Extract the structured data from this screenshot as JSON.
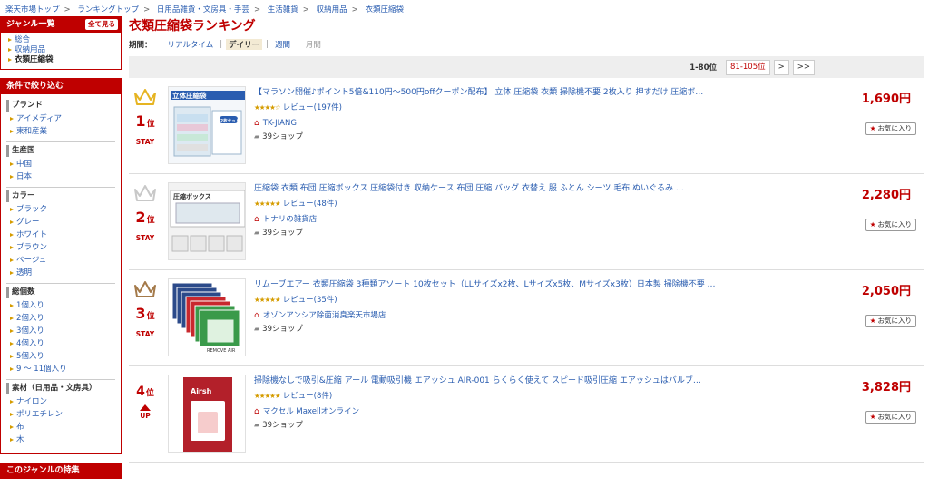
{
  "breadcrumb": [
    "楽天市場トップ",
    "ランキングトップ",
    "日用品雑貨・文房具・手芸",
    "生活雑貨",
    "収納用品",
    "衣類圧縮袋"
  ],
  "sidebar": {
    "genre_title": "ジャンル一覧",
    "all_button": "全て見る",
    "genres": [
      {
        "label": "総合",
        "current": false
      },
      {
        "label": "収納用品",
        "current": false
      },
      {
        "label": "衣類圧縮袋",
        "current": true
      }
    ],
    "filter_title": "条件で絞り込む",
    "filters": [
      {
        "heading": "ブランド",
        "items": [
          "アイメディア",
          "東和産業"
        ]
      },
      {
        "heading": "生産国",
        "items": [
          "中国",
          "日本"
        ]
      },
      {
        "heading": "カラー",
        "items": [
          "ブラック",
          "グレー",
          "ホワイト",
          "ブラウン",
          "ベージュ",
          "透明"
        ]
      },
      {
        "heading": "総個数",
        "items": [
          "1個入り",
          "2個入り",
          "3個入り",
          "4個入り",
          "5個入り",
          "9 ～ 11個入り"
        ]
      },
      {
        "heading": "素材（日用品・文房具）",
        "items": [
          "ナイロン",
          "ポリエチレン",
          "布",
          "木"
        ]
      }
    ],
    "feature_title": "このジャンルの特集"
  },
  "main": {
    "title": "衣類圧縮袋ランキング",
    "period": {
      "label": "期間：",
      "options": [
        {
          "label": "リアルタイム",
          "state": "link"
        },
        {
          "label": "デイリー",
          "state": "active"
        },
        {
          "label": "週間",
          "state": "link"
        },
        {
          "label": "月間",
          "state": "disabled"
        }
      ]
    },
    "pagination": {
      "current": "1-80位",
      "range": "81-105位",
      "next": ">",
      "last": ">>"
    },
    "fav_label": "お気に入り",
    "items": [
      {
        "rank": "1",
        "rank_suffix": "位",
        "status": "STAY",
        "crown": "gold",
        "name": "【マラソン開催♪ポイント5倍&110円～500円offクーポン配布】 立体 圧縮袋 衣類 掃除機不要 2枚入り 押すだけ 圧縮ボ…",
        "stars": 4,
        "review": "レビュー(197件)",
        "shop": "TK-JIANG",
        "shops": "39ショップ",
        "price": "1,690円",
        "thumb_text": "立体圧縮袋",
        "thumb_badge": "2枚セット"
      },
      {
        "rank": "2",
        "rank_suffix": "位",
        "status": "STAY",
        "crown": "silver",
        "name": "圧縮袋 衣類 布団 圧縮ボックス 圧縮袋付き 収納ケース 布団 圧縮 バッグ 衣替え 服 ふとん シーツ 毛布 ぬいぐるみ …",
        "stars": 4.5,
        "review": "レビュー(48件)",
        "shop": "トナリの雑貨店",
        "shops": "39ショップ",
        "price": "2,280円",
        "thumb_text": "圧縮ボックス"
      },
      {
        "rank": "3",
        "rank_suffix": "位",
        "status": "STAY",
        "crown": "bronze",
        "name": "リムーブエアー 衣類圧縮袋 3種類アソート 10枚セット（LLサイズx2枚、Lサイズx5枚、Mサイズx3枚）日本製 掃除機不要 …",
        "stars": 4.5,
        "review": "レビュー(35件)",
        "shop": "オゾンアンシア除菌消臭楽天市場店",
        "shops": "39ショップ",
        "price": "2,050円",
        "thumb_text": "REMOVE AIR"
      },
      {
        "rank": "4",
        "rank_suffix": "位",
        "status": "UP",
        "crown": "none",
        "name": "掃除機なしで吸引&圧縮 アール 電動吸引機 エアッシュ AIR-001 らくらく使えて スピード吸引圧縮 エアッシュはバルブ…",
        "stars": 4.5,
        "review": "レビュー(8件)",
        "shop": "マクセル Maxellオンライン",
        "shops": "39ショップ",
        "price": "3,828円",
        "thumb_text": "Airsh"
      }
    ]
  },
  "colors": {
    "accent": "#bf0000",
    "link": "#2a5db0",
    "star": "#d59c00",
    "gold": "#e6b422",
    "silver": "#c8c8c8",
    "bronze": "#a47a4a"
  }
}
